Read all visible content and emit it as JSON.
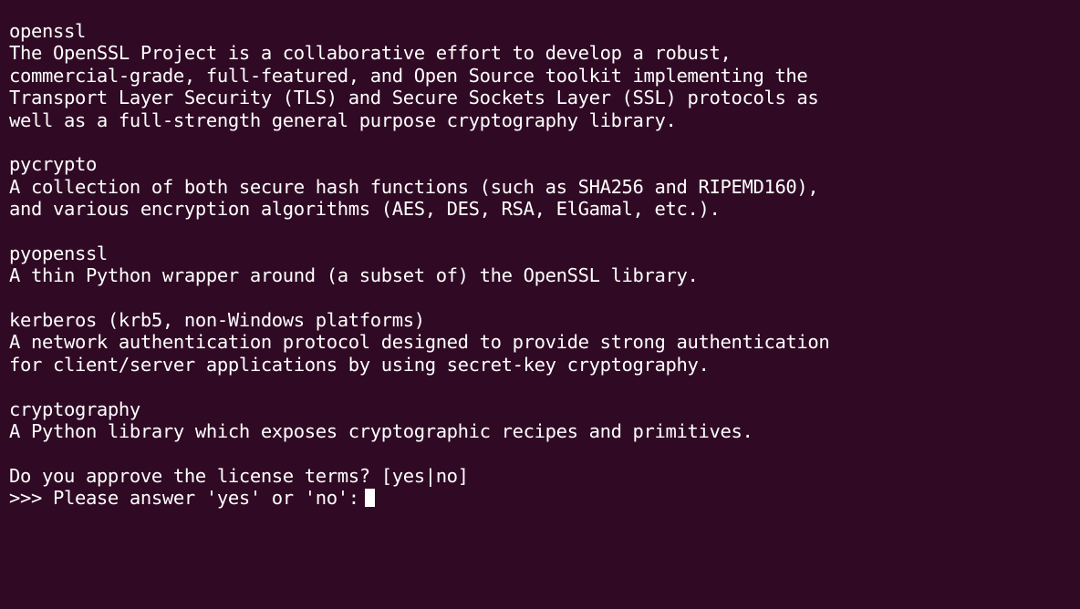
{
  "terminal": {
    "colors": {
      "background": "#300a24",
      "foreground": "#ffffff"
    },
    "lines": [
      "openssl",
      "The OpenSSL Project is a collaborative effort to develop a robust,",
      "commercial-grade, full-featured, and Open Source toolkit implementing the",
      "Transport Layer Security (TLS) and Secure Sockets Layer (SSL) protocols as",
      "well as a full-strength general purpose cryptography library.",
      "",
      "pycrypto",
      "A collection of both secure hash functions (such as SHA256 and RIPEMD160),",
      "and various encryption algorithms (AES, DES, RSA, ElGamal, etc.).",
      "",
      "pyopenssl",
      "A thin Python wrapper around (a subset of) the OpenSSL library.",
      "",
      "kerberos (krb5, non-Windows platforms)",
      "A network authentication protocol designed to provide strong authentication",
      "for client/server applications by using secret-key cryptography.",
      "",
      "cryptography",
      "A Python library which exposes cryptographic recipes and primitives.",
      "",
      "Do you approve the license terms? [yes|no]",
      ">>> Please answer 'yes' or 'no':"
    ]
  }
}
